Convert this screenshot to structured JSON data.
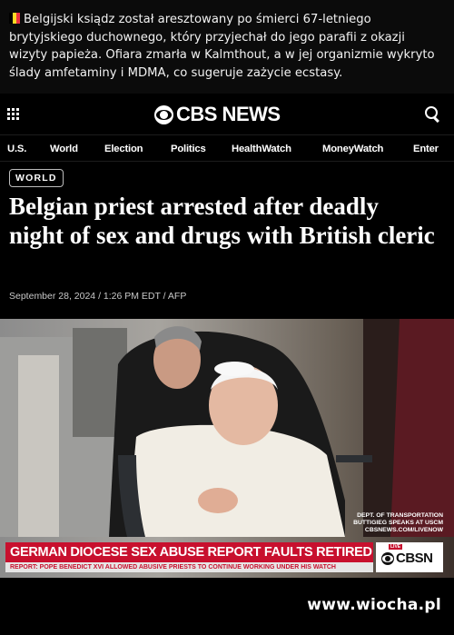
{
  "caption": {
    "flag_icon": "belgium-flag-icon",
    "flag_colors": [
      "#000000",
      "#fdda24",
      "#ef3340"
    ],
    "text": "Belgijski ksiądz został aresztowany po śmierci 67-letniego brytyjskiego duchownego, który przyjechał do jego parafii z okazji wizyty papieża. Ofiara zmarła w Kalmthout, a w jej organizmie wykryto ślady amfetaminy i MDMA, co sugeruje zażycie ecstasy."
  },
  "header": {
    "menu_icon": "grid-menu-icon",
    "logo_icon": "cbs-eye-icon",
    "logo_text": "CBS NEWS",
    "search_icon": "search-icon"
  },
  "nav": {
    "items": [
      "U.S.",
      "World",
      "Election",
      "Politics",
      "HealthWatch",
      "MoneyWatch",
      "Enter"
    ]
  },
  "article": {
    "badge": "WORLD",
    "headline": "Belgian priest arrested after deadly night of sex and drugs with British cleric",
    "dateline": "September 28, 2024 / 1:26 PM EDT / AFP"
  },
  "photo": {
    "credit": "DEPT. OF TRANSPORTATION BUTTIGIEG SPEAKS AT USCM",
    "credit_url": "cbsnews.com/livenow",
    "lower_third_main": "GERMAN DIOCESE SEX ABUSE REPORT FAULTS RETIRED POPE",
    "lower_third_sub": "REPORT: POPE BENEDICT XVI ALLOWED ABUSIVE PRIESTS TO CONTINUE WORKING UNDER HIS WATCH",
    "network_live": "LIVE",
    "network_logo": "CBSN"
  },
  "watermark": "www.wiocha.pl"
}
